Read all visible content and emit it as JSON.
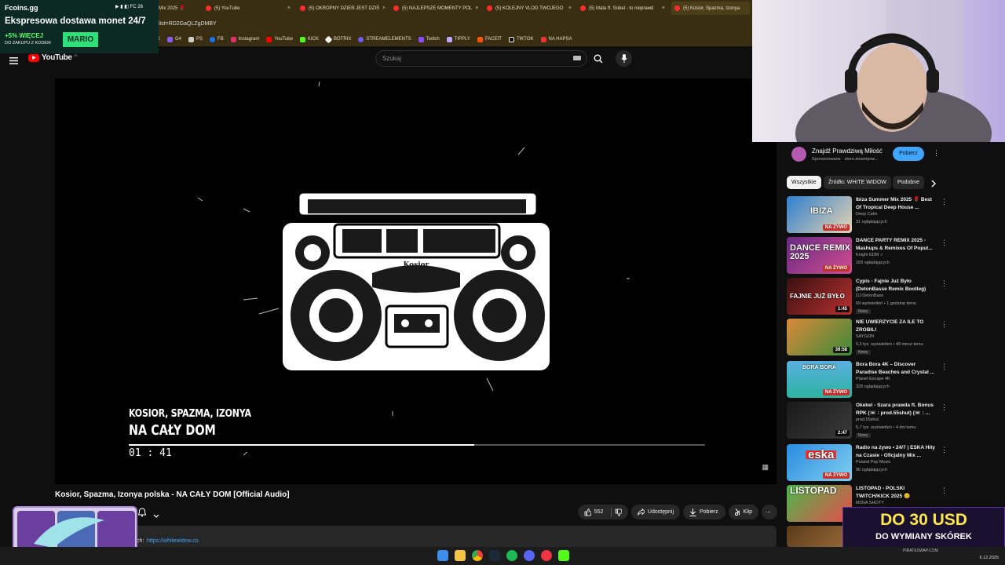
{
  "browser": {
    "tabs": [
      {
        "label": "Mix 2025 🌹"
      },
      {
        "label": "(5) YouTube"
      },
      {
        "label": "(5) OKROPNY DZIEŃ JEST DZIŚ"
      },
      {
        "label": "(5) NAJLEPSZE MOMENTY POL"
      },
      {
        "label": "(5) KOLEJNY VLOG TWOJEGO"
      },
      {
        "label": "(5) Mata ft. Sobel - to nieprawd"
      },
      {
        "label": "(5) Kosior, Spazma, Izonya"
      }
    ],
    "url": "list=RD2GaQLZgDMBY",
    "bookmarks": [
      "K",
      "G4",
      "PS",
      "FB",
      "Instagram",
      "YouTube",
      "KICK",
      "BOTRIX",
      "STREAMELEMENTS",
      "Twitch",
      "TIPPLY",
      "FACEIT",
      "TIKTOK",
      "NA HAPSA"
    ]
  },
  "promo": {
    "brand": "Fcoins.gg",
    "headline": "Ekspresowa dostawa monet 24/7",
    "bonus": "+5% WIĘCEJ",
    "bonus_sub": "DO ZAKUPU Z KODEM",
    "code": "MARIO",
    "status": "FC 26"
  },
  "youtube": {
    "logo_text": "YouTube",
    "logo_region": "PL",
    "search_placeholder": "Szukaj"
  },
  "video": {
    "artists": "KOSIOR, SPAZMA, IZONYA",
    "song": "NA CAŁY DOM",
    "time": "01 : 41",
    "progress": 0.6,
    "label_name": "Kosior",
    "title": "Kosior, Spazma, Izonya polska - NA CAŁY DOM [Official Audio]",
    "likes": "552",
    "share": "Udostępnij",
    "download": "Pobierz",
    "clip": "Klip",
    "desc_label": "ch:",
    "desc_link": "https://whitewidow.co"
  },
  "sidebar": {
    "ad": {
      "title": "Znajdź Prawdziwą Miłość",
      "sub": "Sponsorowane · store.steampow...",
      "button": "Pobierz"
    },
    "chips": [
      "Wszystkie",
      "Źródło: WHITE WIDOW",
      "Podobne"
    ],
    "recommendations": [
      {
        "thumb": "IBIZA",
        "title": "Ibiza Summer Mix 2025 🌹 Best Of Tropical Deep House ...",
        "channel": "Deep Calm",
        "meta": "31 oglądających",
        "overlay": "NA ŻYWO",
        "badge": ""
      },
      {
        "thumb": "DANCE REMIX 2025",
        "title": "DANCE PARTY REMIX 2025 - Mashups & Remixes Of Popul...",
        "channel": "Knight EDM ✓",
        "meta": "169 oglądających",
        "overlay": "NA ŻYWO",
        "badge": ""
      },
      {
        "thumb": "FAJNIE JUŻ BYŁO",
        "title": "Cypis - Fajnie Już Było (DetonBasse Remix Bootleg)",
        "channel": "DJ DetonBass",
        "meta": "69 wyświetleń • 1 godzinę temu",
        "overlay": "1:45",
        "badge": "Nowy"
      },
      {
        "thumb": "",
        "title": "NIE UWIERZYCIE ZA ILE TO ZROBIL!",
        "channel": "SAYGON",
        "meta": "5,3 tys. wyświetleń • 49 minut temu",
        "overlay": "39:58",
        "badge": "Nowy"
      },
      {
        "thumb": "BORA BORA",
        "title": "Bora Bora 4K – Discover Paradise Beaches and Crystal ...",
        "channel": "Planet Escape 4K",
        "meta": "328 oglądających",
        "overlay": "NA ŻYWO",
        "badge": ""
      },
      {
        "thumb": "",
        "title": "Okekel - Szara prawda ft. Bonus RPK (📼 : prod.55shut) (📼 : ...",
        "channel": "prod.55shut",
        "meta": "5,7 tys. wyświetleń • 4 dni temu",
        "overlay": "2:47",
        "badge": "Nowy"
      },
      {
        "thumb": "eska",
        "title": "Radio na żywo • 24/7 | ESKA Hity na Czasie - Oficjalny Mix ...",
        "channel": "Poland Pop Music",
        "meta": "96 oglądających",
        "overlay": "NA ŻYWO",
        "badge": ""
      },
      {
        "thumb": "LISTOPAD",
        "title": "LISTOPAD - POLSKI TWITCH/KICK 2025 😊",
        "channel": "M3GA SHOTY",
        "meta": "",
        "overlay": "",
        "badge": ""
      }
    ]
  },
  "right_promo": {
    "line1": "DO 30 USD",
    "line2": "DO WYMIANY SKÓREK",
    "site": "PIRATESWAP.COM"
  },
  "taskbar": {
    "date": "6.12.2025"
  },
  "colors": {
    "accent": "#3ea6ff",
    "live": "#c4302b",
    "promo_green": "#2ee07a"
  }
}
